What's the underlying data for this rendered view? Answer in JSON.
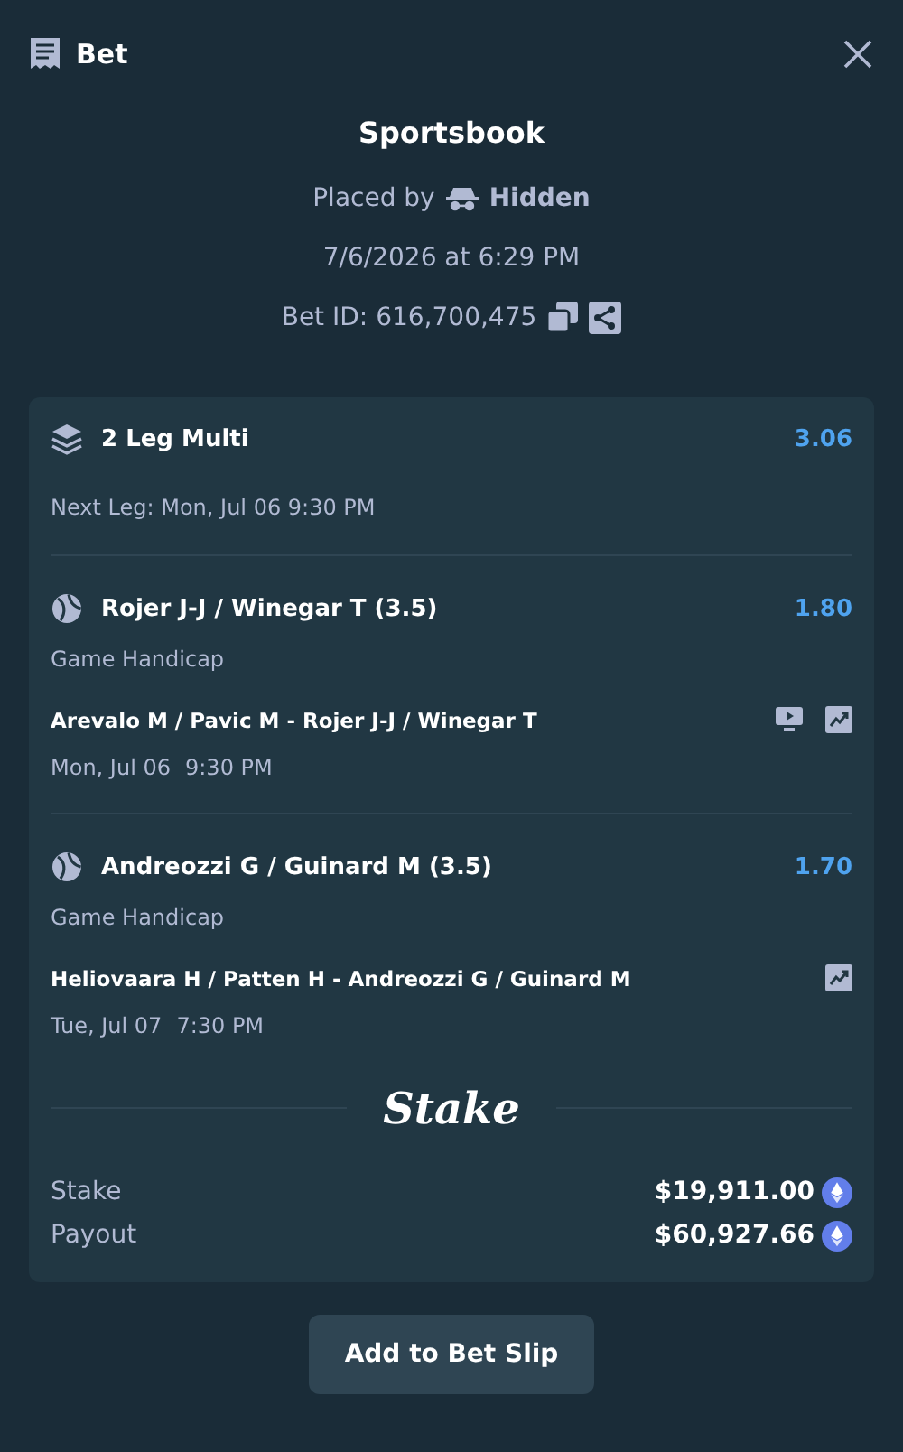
{
  "header": {
    "title": "Bet"
  },
  "summary": {
    "title": "Sportsbook",
    "placed_by_label": "Placed by",
    "placed_by_user": "Hidden",
    "placed_at": "7/6/2026 at 6:29 PM",
    "bet_id": "Bet ID: 616,700,475"
  },
  "multi": {
    "title": "2 Leg Multi",
    "odds": "3.06",
    "next_leg": "Next Leg: Mon, Jul 06 9:30 PM"
  },
  "legs": [
    {
      "selection": "Rojer J-J / Winegar T (3.5)",
      "odds": "1.80",
      "market": "Game Handicap",
      "event": "Arevalo M / Pavic M - Rojer J-J / Winegar T",
      "date": "Mon, Jul 06",
      "time": "9:30 PM",
      "live_stream": true,
      "stats": true
    },
    {
      "selection": "Andreozzi G / Guinard M (3.5)",
      "odds": "1.70",
      "market": "Game Handicap",
      "event": "Heliovaara H / Patten H - Andreozzi G / Guinard M",
      "date": "Tue, Jul 07",
      "time": "7:30 PM",
      "live_stream": false,
      "stats": true
    }
  ],
  "brand": "Stake",
  "totals": [
    {
      "label": "Stake",
      "amount": "$19,911.00"
    },
    {
      "label": "Payout",
      "amount": "$60,927.66"
    }
  ],
  "action": "Add to Bet Slip"
}
